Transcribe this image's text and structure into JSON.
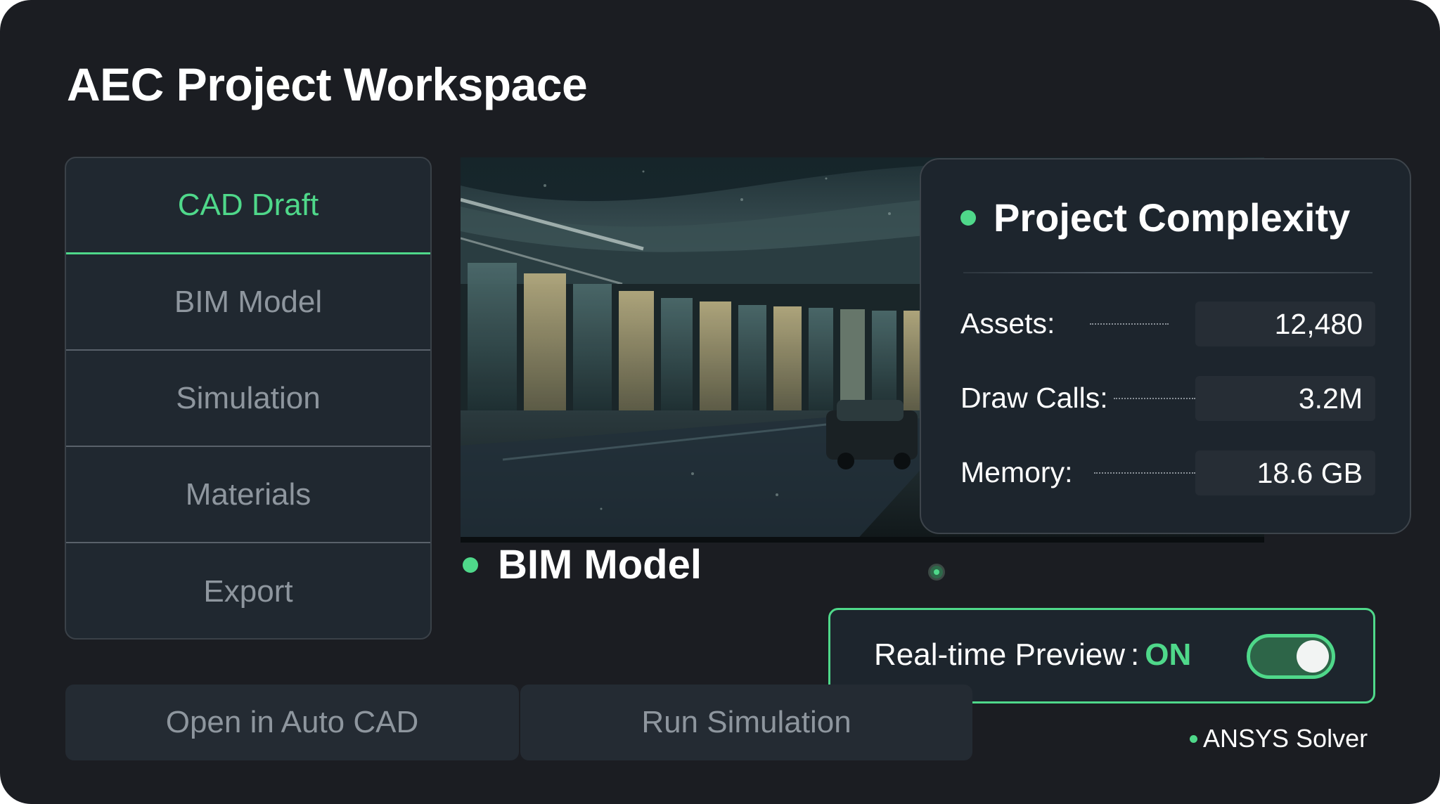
{
  "header": {
    "title": "AEC Project Workspace"
  },
  "tabs": [
    {
      "label": "CAD Draft",
      "active": true
    },
    {
      "label": "BIM Model",
      "active": false
    },
    {
      "label": "Simulation",
      "active": false
    },
    {
      "label": "Materials",
      "active": false
    },
    {
      "label": "Export",
      "active": false
    }
  ],
  "preview": {
    "caption": "BIM Model"
  },
  "complexity": {
    "title": "Project Complexity",
    "metrics": [
      {
        "label": "Assets:",
        "value": "12,480"
      },
      {
        "label": "Draw Calls:",
        "value": "3.2M"
      },
      {
        "label": "Memory:",
        "value": "18.6 GB"
      }
    ]
  },
  "realtime": {
    "label": "Real-time Preview",
    "separator": ":",
    "state": "ON",
    "enabled": true
  },
  "actions": {
    "open_autocad": "Open in Auto CAD",
    "run_simulation": "Run Simulation"
  },
  "solver": {
    "label": "ANSYS Solver"
  },
  "colors": {
    "accent": "#4fd88a",
    "background": "#1b1d22",
    "panel": "#202830"
  }
}
